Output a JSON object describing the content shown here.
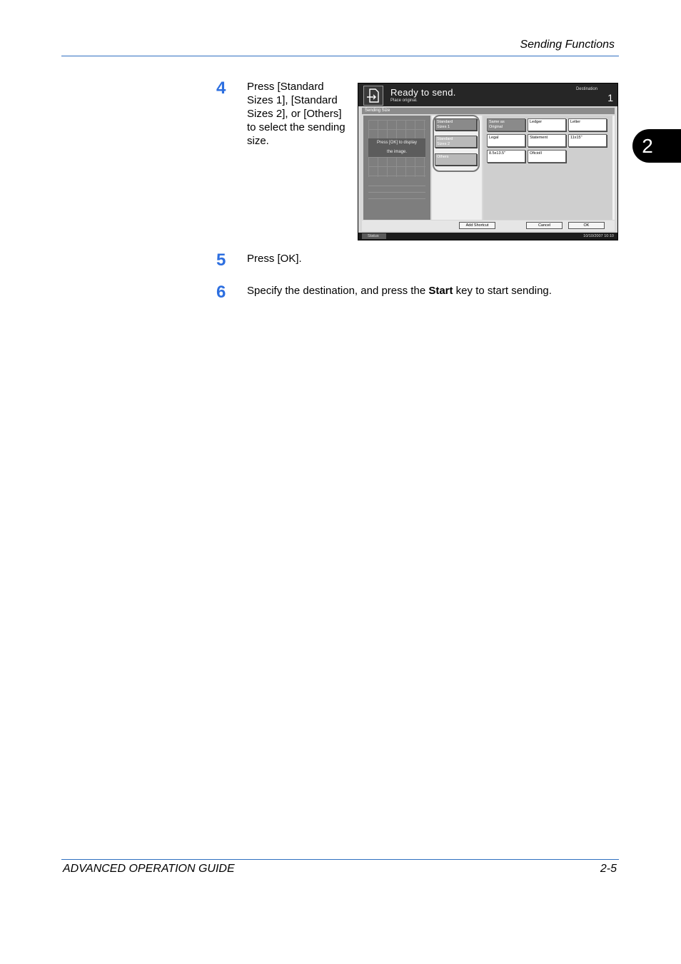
{
  "header": {
    "section_title": "Sending Functions"
  },
  "chapter_tab": {
    "number": "2"
  },
  "steps": [
    {
      "number": "4",
      "lines": [
        "Press [Standard",
        "Sizes 1], [Standard",
        "Sizes 2], or [Others]",
        "to select the sending",
        "size."
      ]
    },
    {
      "number": "5",
      "text": "Press [OK]."
    },
    {
      "number": "6",
      "text_before": "Specify the destination, and press the ",
      "bold": "Start",
      "text_after": " key to start sending."
    }
  ],
  "screen": {
    "status_title": "Ready to send.",
    "status_subtitle": "Place original.",
    "destination_label": "Destination",
    "destination_count": "1",
    "section_label": "Sending Size",
    "preview_message_line1": "Press [OK] to display",
    "preview_message_line2": "the image.",
    "tabs": [
      {
        "line1": "Standard",
        "line2": "Sizes 1"
      },
      {
        "line1": "Standard",
        "line2": "Sizes 2"
      },
      {
        "line1": "Others",
        "line2": ""
      }
    ],
    "sizes": [
      "Same as",
      "Original",
      "Ledger",
      "Letter",
      "Legal",
      "Statement",
      "11x15\"",
      "8.5x13.5\"",
      "OficioII"
    ],
    "buttons": {
      "add_shortcut": "Add Shortcut",
      "cancel": "Cancel",
      "ok": "OK"
    },
    "status_bar": {
      "label": "Status",
      "datetime": "10/10/2007   10:10"
    }
  },
  "footer": {
    "guide_title": "ADVANCED OPERATION GUIDE",
    "page_number": "2-5"
  },
  "colors": {
    "accent_blue": "#2d6fe0",
    "rule_blue": "#2f6fc0"
  }
}
